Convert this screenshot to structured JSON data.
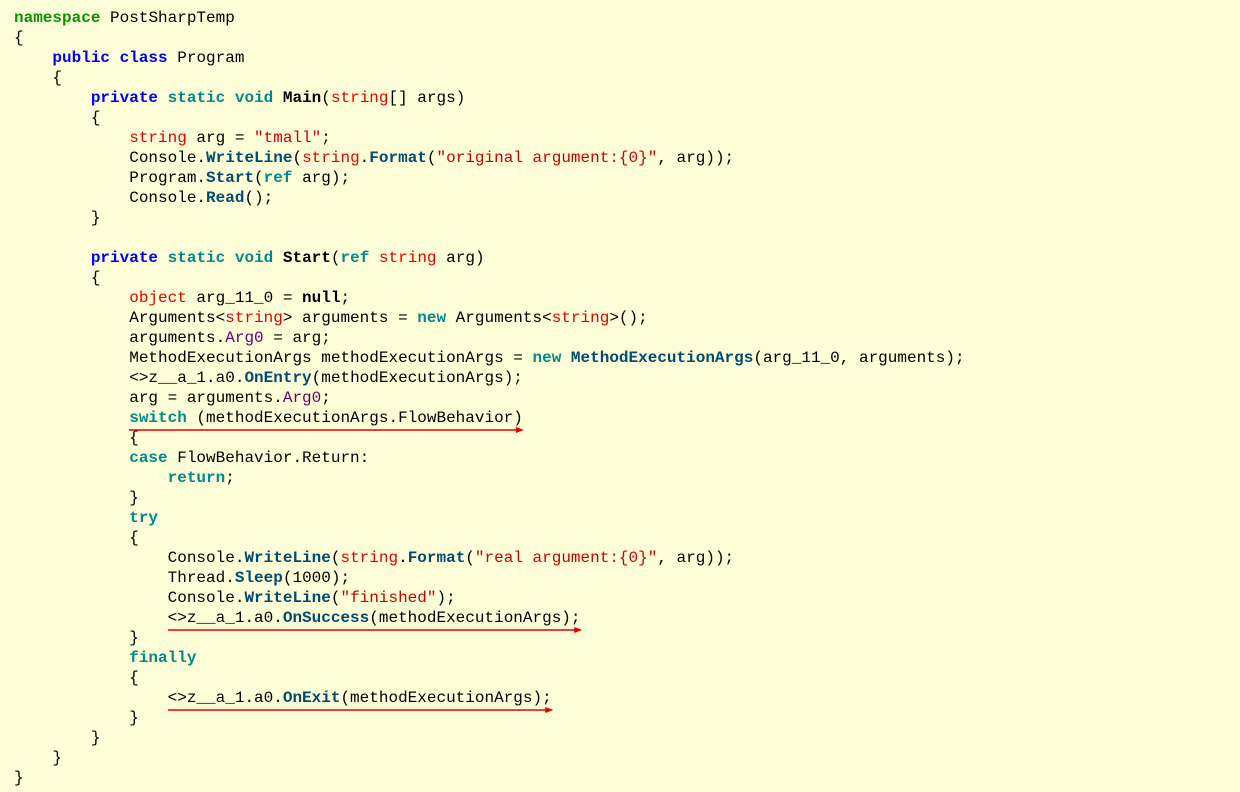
{
  "ns": {
    "kw": "namespace",
    "name": "PostSharpTemp"
  },
  "cls": {
    "kw_public": "public",
    "kw_class": "class",
    "name": "Program"
  },
  "main": {
    "kw_private": "private",
    "kw_static": "static",
    "kw_void": "void",
    "name": "Main",
    "param_type": "string",
    "param_name": "[] args",
    "l1_kw_string": "string",
    "l1_var": " arg = ",
    "l1_str": "\"tmall\"",
    "l2_console": "Console.",
    "l2_wl": "WriteLine",
    "l2_p1": "(",
    "l2_string": "string",
    "l2_dot": ".",
    "l2_format": "Format",
    "l2_p2": "(",
    "l2_str": "\"original argument:{0}\"",
    "l2_rest": ", arg));",
    "l3_prog": "Program.",
    "l3_start": "Start",
    "l3_p1": "(",
    "l3_ref": "ref",
    "l3_rest": " arg);",
    "l4_console": "Console.",
    "l4_read": "Read",
    "l4_rest": "();"
  },
  "start": {
    "kw_private": "private",
    "kw_static": "static",
    "kw_void": "void",
    "name": "Start",
    "p1": "(",
    "kw_ref": "ref",
    "param_type": " string",
    "param_name": " arg)",
    "b1_obj": "object",
    "b1_var": " arg_11_0 = ",
    "b1_null": "null",
    "b1_end": ";",
    "b2_a": "Arguments<",
    "b2_str": "string",
    "b2_b": "> arguments = ",
    "b2_new": "new",
    "b2_c": " Arguments<",
    "b2_str2": "string",
    "b2_d": ">();",
    "b3_a": "arguments.",
    "b3_f": "Arg0",
    "b3_b": " = arg;",
    "b4_a": "MethodExecutionArgs methodExecutionArgs = ",
    "b4_new": "new",
    "b4_sp": " ",
    "b4_type": "MethodExecutionArgs",
    "b4_b": "(arg_11_0, arguments);",
    "b5_a": "<>z__a_1.a0.",
    "b5_m": "OnEntry",
    "b5_b": "(methodExecutionArgs);",
    "b6_a": "arg = arguments.",
    "b6_f": "Arg0",
    "b6_b": ";",
    "b7_switch": "switch",
    "b7_rest": " (methodExecutionArgs.FlowBehavior)",
    "b8_case": "case",
    "b8_rest": " FlowBehavior.Return:",
    "b9_ret": "return",
    "b9_end": ";",
    "b10_try": "try",
    "b11_console": "Console.",
    "b11_wl": "WriteLine",
    "b11_p1": "(",
    "b11_string": "string",
    "b11_dot": ".",
    "b11_format": "Format",
    "b11_p2": "(",
    "b11_str": "\"real argument:{0}\"",
    "b11_rest": ", arg));",
    "b12_a": "Thread.",
    "b12_m": "Sleep",
    "b12_b": "(1000);",
    "b13_console": "Console.",
    "b13_wl": "WriteLine",
    "b13_p1": "(",
    "b13_str": "\"finished\"",
    "b13_rest": ");",
    "b14_a": "<>z__a_1.a0.",
    "b14_m": "OnSuccess",
    "b14_b": "(methodExecutionArgs);",
    "b15_fin": "finally",
    "b16_a": "<>z__a_1.a0.",
    "b16_m": "OnExit",
    "b16_b": "(methodExecutionArgs);"
  }
}
